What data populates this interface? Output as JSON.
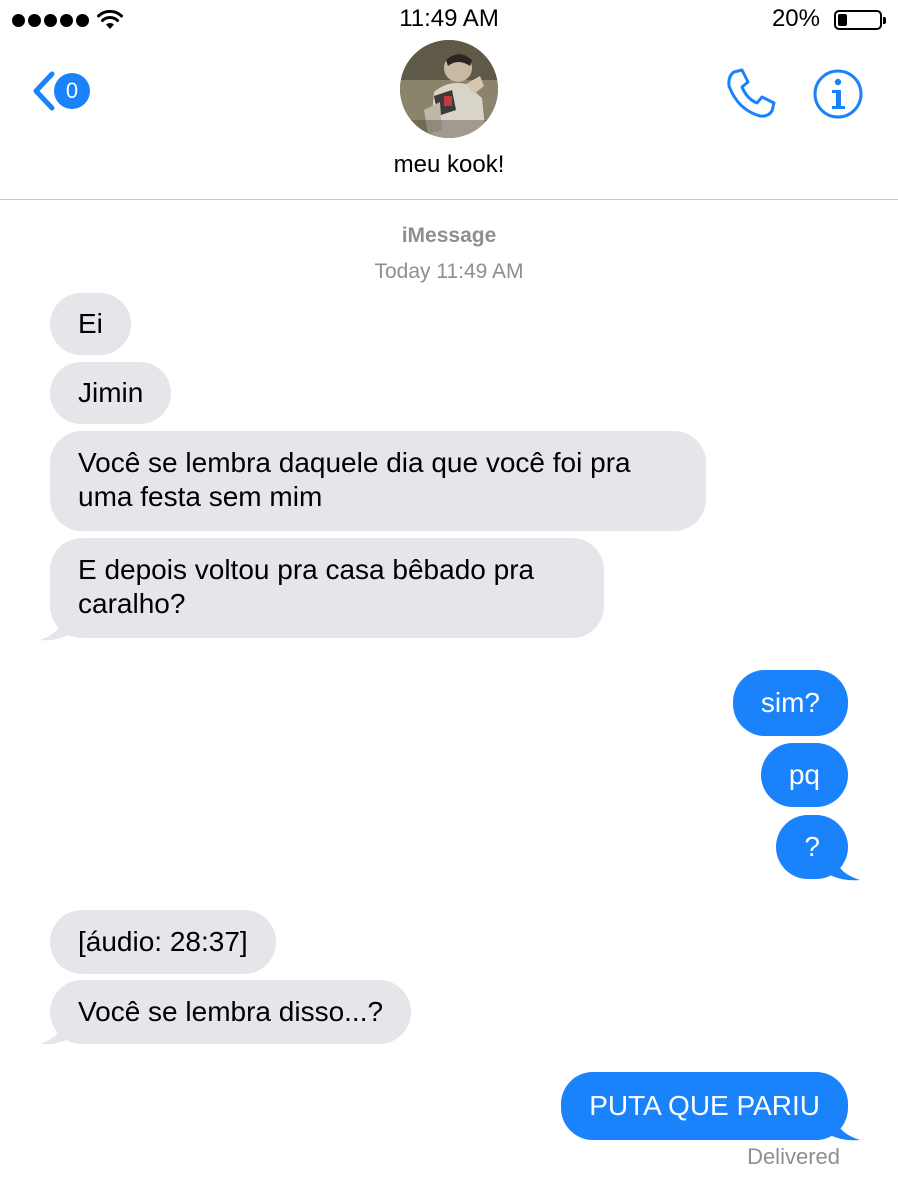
{
  "status_bar": {
    "time": "11:49 AM",
    "battery_percent": "20%",
    "signal_bars": 5,
    "battery_level": 0.2
  },
  "header": {
    "back_badge": "0",
    "contact_name": "meu kook!",
    "icons": [
      "chevron-left-icon",
      "phone-icon",
      "info-icon"
    ],
    "accent_color": "#1a82fb"
  },
  "conversation": {
    "service": "iMessage",
    "timestamp": "Today 11:49 AM",
    "messages": [
      {
        "from": "them",
        "text": "Ei"
      },
      {
        "from": "them",
        "text": "Jimin"
      },
      {
        "from": "them",
        "text": "Você se lembra daquele dia que você foi pra uma festa sem mim"
      },
      {
        "from": "them",
        "text": "E depois voltou pra casa bêbado pra caralho?"
      },
      {
        "from": "me",
        "text": "sim?"
      },
      {
        "from": "me",
        "text": "pq"
      },
      {
        "from": "me",
        "text": "?"
      },
      {
        "from": "them",
        "text": "[áudio: 28:37]"
      },
      {
        "from": "them",
        "text": "Você se lembra disso...?"
      },
      {
        "from": "me",
        "text": "PUTA QUE PARIU"
      }
    ],
    "delivered_label": "Delivered"
  },
  "colors": {
    "incoming_bubble": "#e5e5ea",
    "outgoing_bubble": "#1a82fb",
    "meta_text": "#8e8e93"
  }
}
